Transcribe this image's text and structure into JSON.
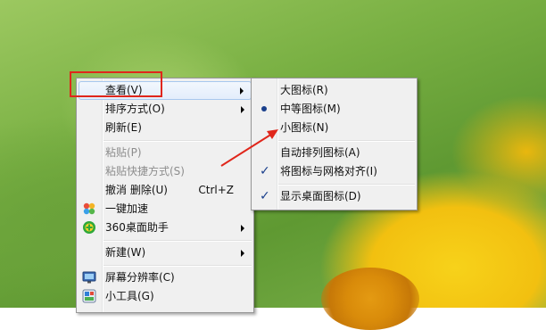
{
  "context_menu": {
    "items": [
      {
        "label": "查看(V)",
        "shortcut": "",
        "submenu": true,
        "disabled": false,
        "icon": ""
      },
      {
        "label": "排序方式(O)",
        "shortcut": "",
        "submenu": true,
        "disabled": false,
        "icon": ""
      },
      {
        "label": "刷新(E)",
        "shortcut": "",
        "submenu": false,
        "disabled": false,
        "icon": ""
      },
      {
        "label": "粘贴(P)",
        "shortcut": "",
        "submenu": false,
        "disabled": true,
        "icon": ""
      },
      {
        "label": "粘贴快捷方式(S)",
        "shortcut": "",
        "submenu": false,
        "disabled": true,
        "icon": ""
      },
      {
        "label": "撤消 删除(U)",
        "shortcut": "Ctrl+Z",
        "submenu": false,
        "disabled": false,
        "icon": ""
      },
      {
        "label": "一键加速",
        "shortcut": "",
        "submenu": false,
        "disabled": false,
        "icon": "speedup-icon"
      },
      {
        "label": "360桌面助手",
        "shortcut": "",
        "submenu": true,
        "disabled": false,
        "icon": "360-assistant-icon"
      },
      {
        "label": "新建(W)",
        "shortcut": "",
        "submenu": true,
        "disabled": false,
        "icon": ""
      },
      {
        "label": "屏幕分辨率(C)",
        "shortcut": "",
        "submenu": false,
        "disabled": false,
        "icon": "monitor-icon"
      },
      {
        "label": "小工具(G)",
        "shortcut": "",
        "submenu": false,
        "disabled": false,
        "icon": "gadget-icon"
      }
    ]
  },
  "view_submenu": {
    "items": [
      {
        "label": "大图标(R)",
        "mark": ""
      },
      {
        "label": "中等图标(M)",
        "mark": "radio"
      },
      {
        "label": "小图标(N)",
        "mark": ""
      },
      {
        "label": "自动排列图标(A)",
        "mark": ""
      },
      {
        "label": "将图标与网格对齐(I)",
        "mark": "check"
      },
      {
        "label": "显示桌面图标(D)",
        "mark": "check"
      }
    ]
  },
  "colors": {
    "annotation": "#e0261b",
    "menu_bg": "#f0f0f0",
    "hover_border": "#a8c8ee"
  }
}
